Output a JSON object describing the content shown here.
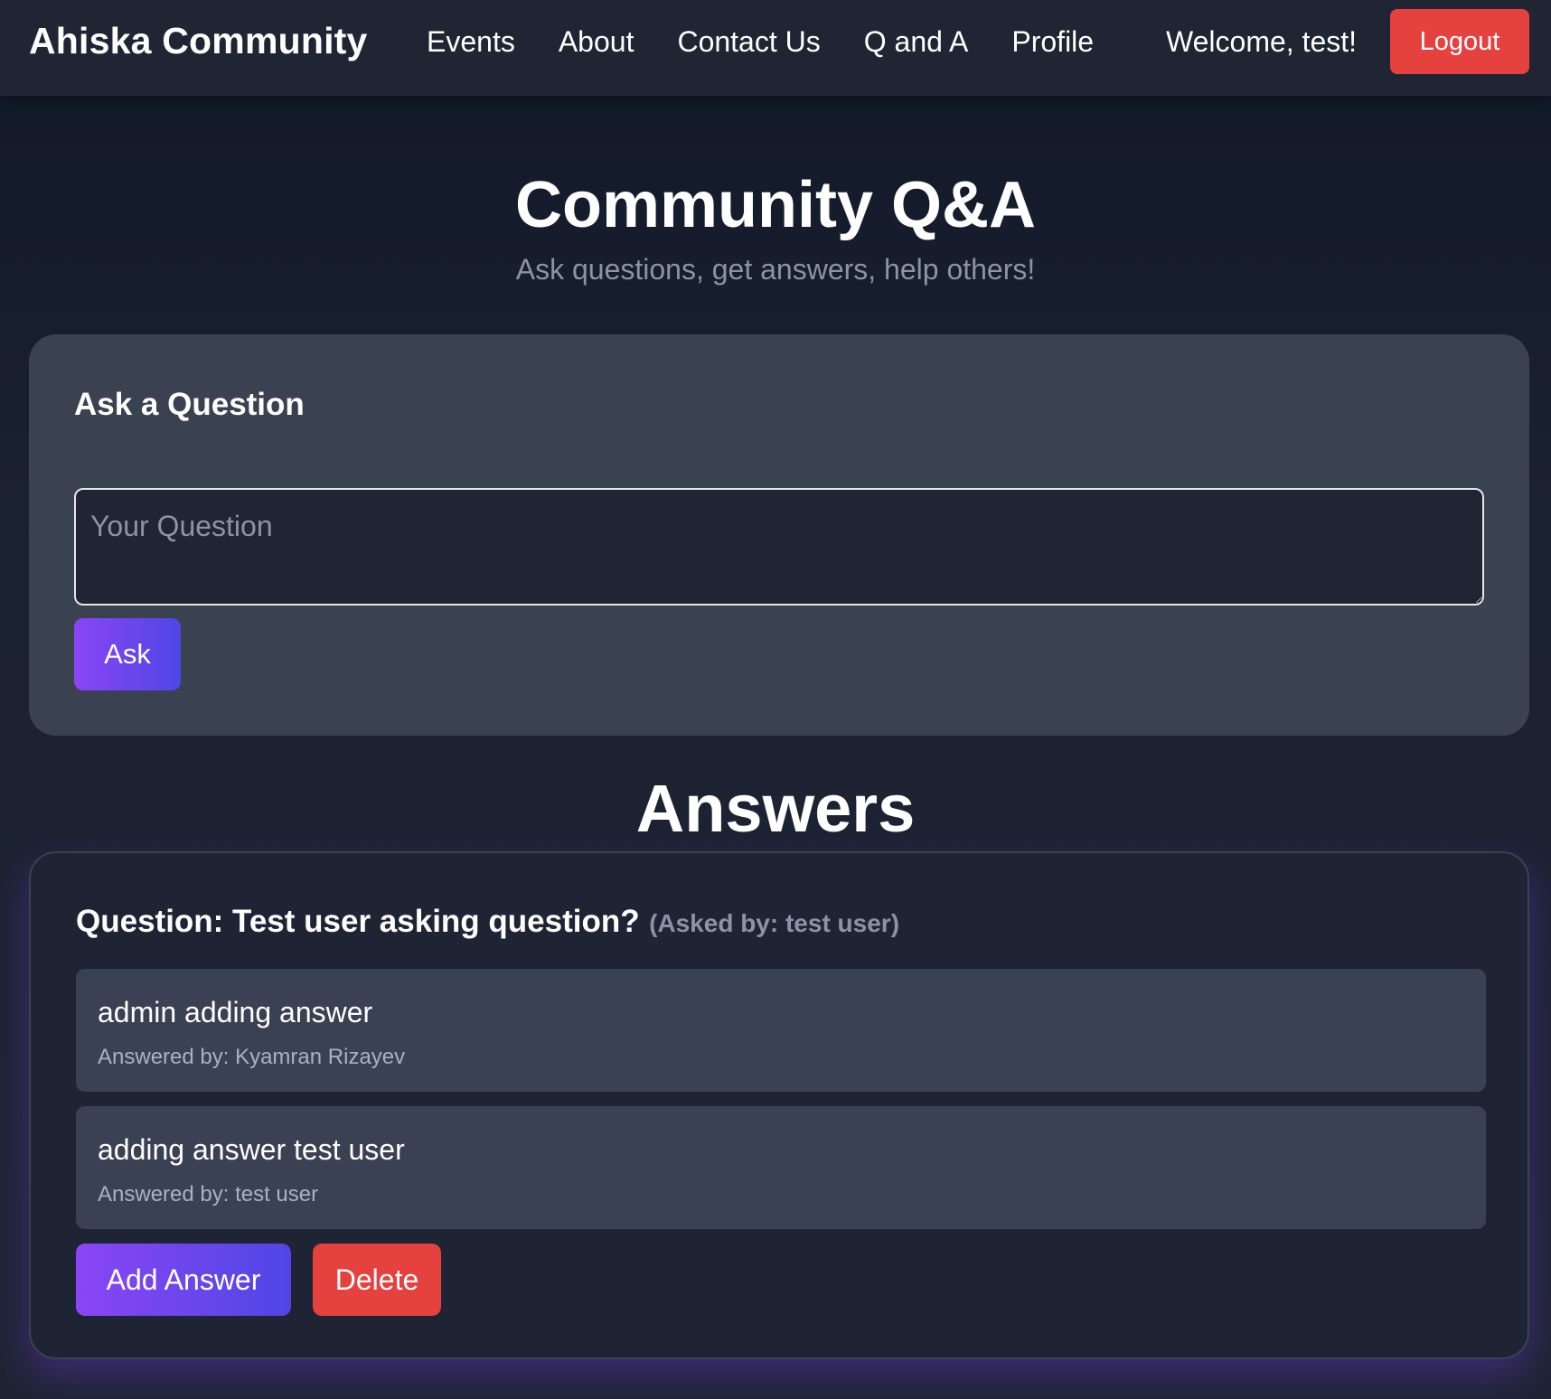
{
  "navbar": {
    "brand": "Ahiska Community",
    "links": [
      "Events",
      "About",
      "Contact Us",
      "Q and A",
      "Profile"
    ],
    "welcome": "Welcome, test!",
    "logout_label": "Logout"
  },
  "hero": {
    "title": "Community Q&A",
    "subtitle": "Ask questions, get answers, help others!"
  },
  "ask": {
    "title": "Ask a Question",
    "placeholder": "Your Question",
    "button_label": "Ask"
  },
  "answers_section": {
    "title": "Answers",
    "questions": [
      {
        "question": "Question: Test user asking question?",
        "asked_by": "(Asked by: test user)",
        "answers": [
          {
            "text": "admin adding answer",
            "by": "Answered by: Kyamran Rizayev"
          },
          {
            "text": "adding answer test user",
            "by": "Answered by: test user"
          }
        ],
        "add_answer_label": "Add Answer",
        "delete_label": "Delete"
      }
    ]
  },
  "colors": {
    "accent_gradient_start": "#8b45f5",
    "accent_gradient_end": "#4f46e5",
    "danger": "#e5413f",
    "background": "#1e2433",
    "card": "#3a4150"
  }
}
